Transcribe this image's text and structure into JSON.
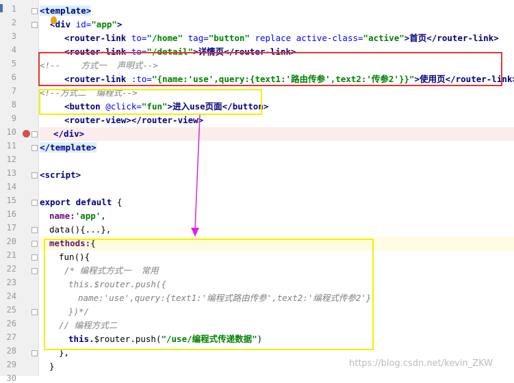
{
  "editor": {
    "line_numbers": [
      "1",
      "2",
      "3",
      "4",
      "5",
      "6",
      "7",
      "8",
      "9",
      "10",
      "11",
      "12",
      "13",
      "14",
      "15",
      "16",
      "17",
      "20",
      "21",
      "22",
      "23",
      "24",
      "25",
      "26",
      "27",
      "28",
      "29",
      "30"
    ],
    "lines": {
      "l1": {
        "a": "<template>"
      },
      "l2": {
        "a": "  <div ",
        "b": "id=",
        "c": "\"app\"",
        "d": ">"
      },
      "l3": {
        "a": "<router-link ",
        "b": "to=",
        "c": "\"/home\" ",
        "d": "tag=",
        "e": "\"button\" ",
        "f": "replace ",
        "g": "active-class=",
        "h": "\"active\"",
        "i": ">首页</router-link>"
      },
      "l4": {
        "a": "<router-link ",
        "b": "to=",
        "c": "\"/detail\"",
        "d": ">详情页</router-link>"
      },
      "l5": {
        "a": "<!--    方式一  声明式-->"
      },
      "l6": {
        "a": "<router-link ",
        "b": ":to=",
        "c": "\"{name:",
        "d": "'use'",
        "e": ",query:{text1:",
        "f": "'路由传参'",
        "g": ",text2:",
        "h": "'传参2'",
        "i": "}}\"",
        "j": ">使用页</router-link>"
      },
      "l7": {
        "a": "<!--方式二  编程式-->"
      },
      "l8": {
        "a": "<button ",
        "b": "@click=",
        "c": "\"fun\"",
        "d": ">进入use页面</button>"
      },
      "l9": {
        "a": "<router-view></router-view>"
      },
      "l10": {
        "a": "</div>"
      },
      "l11": {
        "a": "</template>"
      },
      "l13": {
        "a": "<script>"
      },
      "l15": {
        "a": "export default ",
        "b": "{"
      },
      "l16": {
        "a": "name:",
        "b": "'app'",
        "c": ","
      },
      "l17": {
        "a": "data(){...},"
      },
      "l21": {
        "a": "methods:",
        "b": "{"
      },
      "l22": {
        "a": "fun(){"
      },
      "l23": {
        "a": "/* 编程式方式一  常用"
      },
      "l24": {
        "a": "this.$router.push({"
      },
      "l25": {
        "a": "name:'use',query:{text1:'编程式路由传参',text2:'编程式传参2'}"
      },
      "l26": {
        "a": "})*/"
      },
      "l27": {
        "a": "// 编程方式二"
      },
      "l28": {
        "a": "this.",
        "b": "$router.push(",
        "c": "\"/use/编程式传递数据\"",
        "d": ")"
      },
      "l29": {
        "a": "},"
      },
      "l30": {
        "a": "}"
      }
    }
  },
  "watermark": "https://blog.csdn.net/kevin_ZKW",
  "colors": {
    "red_box": "#e53333",
    "yellow_box": "#f0f000",
    "arrow": "#e020e0",
    "breakpoint": "#d64e4e"
  }
}
